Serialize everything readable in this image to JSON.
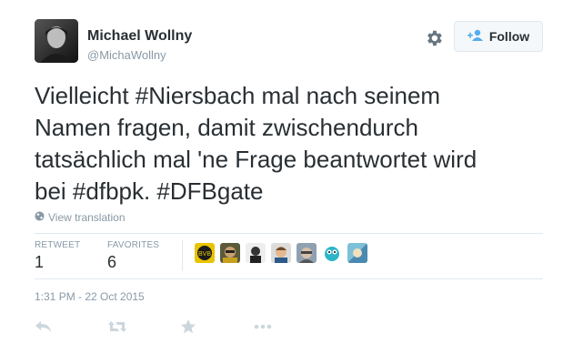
{
  "user": {
    "display_name": "Michael Wollny",
    "handle": "@MichaWollny"
  },
  "header": {
    "follow_label": "Follow",
    "gear_icon": "gear-icon",
    "follow_icon": "add-person-icon"
  },
  "tweet": {
    "lines": [
      "Vielleicht #Niersbach mal nach seinem",
      "Namen fragen, damit zwischendurch",
      "tatsächlich mal 'ne Frage beantwortet wird",
      "bei #dfbpk. #DFBgate"
    ],
    "translate_label": "View translation"
  },
  "stats": {
    "retweets_label": "RETWEET",
    "retweets_value": "1",
    "favorites_label": "FAVORITES",
    "favorites_value": "6",
    "favoriter_avatar_count": 7
  },
  "timestamp": "1:31 PM - 22 Oct 2015",
  "actions": [
    "reply-icon",
    "retweet-icon",
    "favorite-icon",
    "more-icon"
  ],
  "colors": {
    "text": "#292f33",
    "muted": "#8899a6",
    "border": "#e1e8ed",
    "follow_icon": "#55acee"
  }
}
